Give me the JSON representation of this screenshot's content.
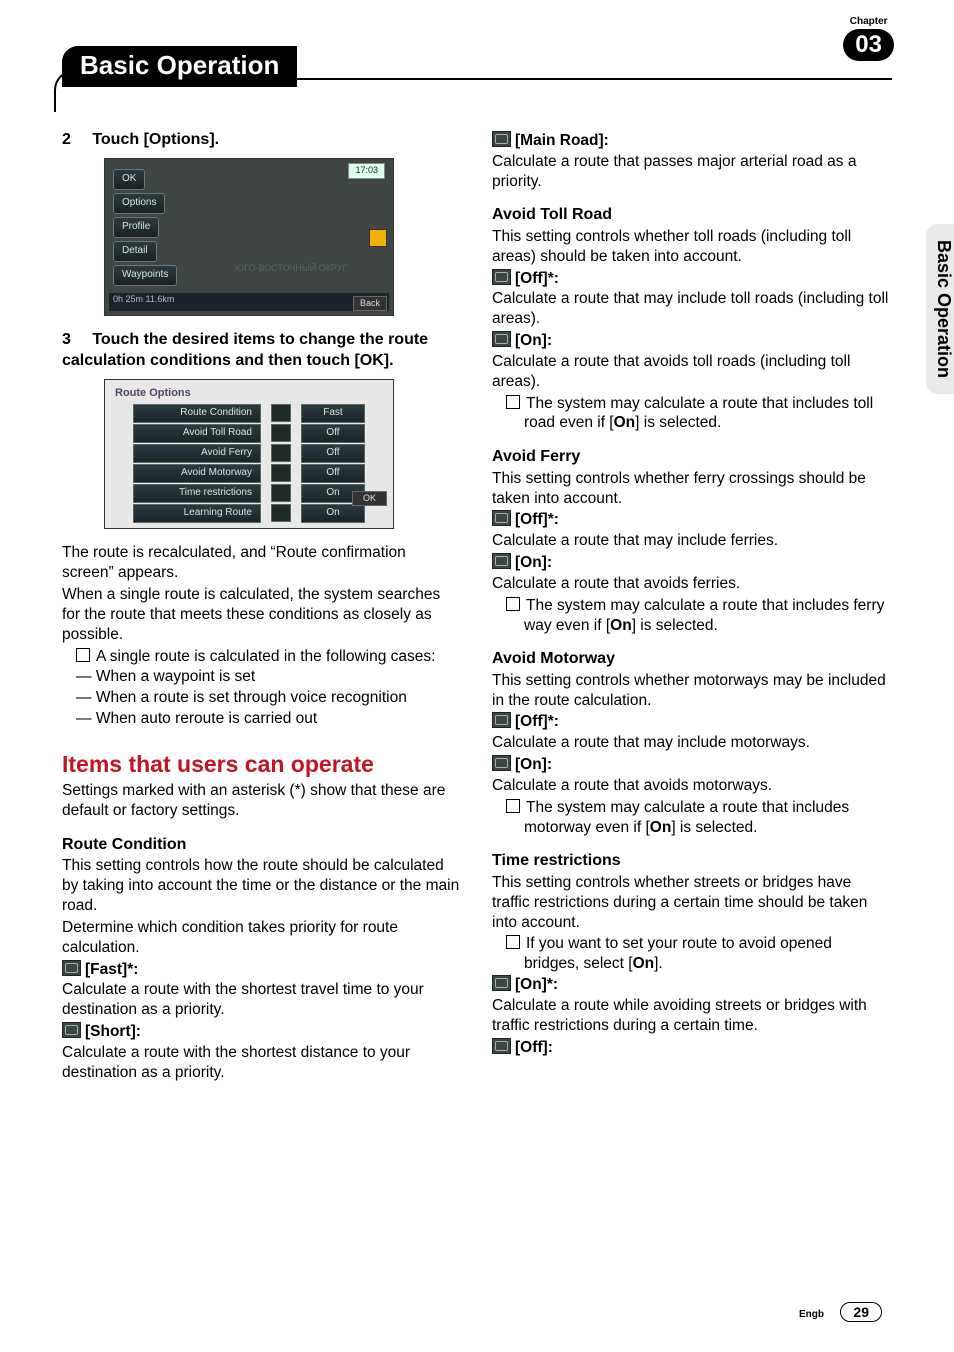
{
  "header": {
    "title": "Basic Operation",
    "chapter_label": "Chapter",
    "chapter_number": "03",
    "side_tab": "Basic Operation"
  },
  "footer": {
    "lang": "Engb",
    "page": "29"
  },
  "left": {
    "step2_num": "2",
    "step2_title": "Touch [Options].",
    "shot1": {
      "b_ok": "OK",
      "b_options": "Options",
      "b_profile": "Profile",
      "b_detail": "Detail",
      "b_waypoints": "Waypoints",
      "clock": "17:03",
      "map_label": "ЮГО-ВОСТОЧНЫЙ ОКРУГ",
      "bottom": "0h 25m   11.6km",
      "back": "Back"
    },
    "step3_num": "3",
    "step3_title": "Touch the desired items to change the route calculation conditions and then touch [OK].",
    "shot2": {
      "title": "Route Options",
      "rows": [
        {
          "lbl": "Route Condition",
          "val": "Fast"
        },
        {
          "lbl": "Avoid Toll Road",
          "val": "Off"
        },
        {
          "lbl": "Avoid Ferry",
          "val": "Off"
        },
        {
          "lbl": "Avoid Motorway",
          "val": "Off"
        },
        {
          "lbl": "Time restrictions",
          "val": "On"
        },
        {
          "lbl": "Learning Route",
          "val": "On"
        }
      ],
      "ok": "OK"
    },
    "para1a": "The route is recalculated, and “Route confirmation screen” appears.",
    "para1b": "When a single route is calculated, the system searches for the route that meets these conditions as closely as possible.",
    "note1": "A single route is calculated in the following cases:",
    "dash1": "When a waypoint is set",
    "dash2": "When a route is set through voice recognition",
    "dash3": "When auto reroute is carried out",
    "h2": "Items that users can operate",
    "intro": "Settings marked with an asterisk (*) show that these are default or factory settings.",
    "rc_h": "Route Condition",
    "rc_p1": "This setting controls how the route should be calculated by taking into account the time or the distance or the main road.",
    "rc_p2": "Determine which condition takes priority for route calculation.",
    "fast_l": "[Fast]*:",
    "fast_d": "Calculate a route with the shortest travel time to your destination as a priority.",
    "short_l": "[Short]:",
    "short_d": "Calculate a route with the shortest distance to your destination as a priority."
  },
  "right": {
    "main_l": "[Main Road]:",
    "main_d": "Calculate a route that passes major arterial road as a priority.",
    "atr_h": "Avoid Toll Road",
    "atr_p": "This setting controls whether toll roads (including toll areas) should be taken into account.",
    "atr_off_l": "[Off]*:",
    "atr_off_d": "Calculate a route that may include toll roads (including toll areas).",
    "atr_on_l": "[On]:",
    "atr_on_d": "Calculate a route that avoids toll roads (including toll areas).",
    "atr_note_a": "The system may calculate a route that includes toll road even if [",
    "atr_note_b": "On",
    "atr_note_c": "] is selected.",
    "af_h": "Avoid Ferry",
    "af_p": "This setting controls whether ferry crossings should be taken into account.",
    "af_off_l": "[Off]*:",
    "af_off_d": "Calculate a route that may include ferries.",
    "af_on_l": "[On]:",
    "af_on_d": "Calculate a route that avoids ferries.",
    "af_note_a": "The system may calculate a route that includes ferry way even if [",
    "af_note_b": "On",
    "af_note_c": "] is selected.",
    "am_h": "Avoid Motorway",
    "am_p": "This setting controls whether motorways may be included in the route calculation.",
    "am_off_l": "[Off]*:",
    "am_off_d": "Calculate a route that may include motorways.",
    "am_on_l": "[On]:",
    "am_on_d": "Calculate a route that avoids motorways.",
    "am_note_a": "The system may calculate a route that includes motorway even if [",
    "am_note_b": "On",
    "am_note_c": "] is selected.",
    "tr_h": "Time restrictions",
    "tr_p": "This setting controls whether streets or bridges have traffic restrictions during a certain time should be taken into account.",
    "tr_note_a": "If you want to set your route to avoid opened bridges, select [",
    "tr_note_b": "On",
    "tr_note_c": "].",
    "tr_on_l": "[On]*:",
    "tr_on_d": "Calculate a route while avoiding streets or bridges with traffic restrictions during a certain time.",
    "tr_off_l": "[Off]:"
  }
}
